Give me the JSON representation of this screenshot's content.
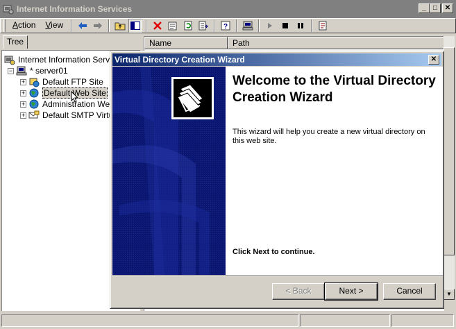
{
  "window": {
    "title": "Internet Information Services",
    "controls": {
      "minimize": "_",
      "maximize": "□",
      "close": "✕"
    }
  },
  "menubar": {
    "items": [
      {
        "label": "Action",
        "accel": "A",
        "rest": "ction"
      },
      {
        "label": "View",
        "accel": "V",
        "rest": "iew"
      }
    ]
  },
  "toolbar": {
    "icons": [
      "back-arrow-icon",
      "forward-arrow-icon",
      "up-folder-icon",
      "show-hide-tree-icon",
      "delete-icon",
      "properties-icon",
      "refresh-icon",
      "export-list-icon",
      "help-icon",
      "computer-icon",
      "start-icon",
      "stop-icon",
      "pause-icon",
      "script-icon"
    ]
  },
  "tabs": {
    "tree": "Tree"
  },
  "tree": {
    "root": "Internet Information Services",
    "server": "* server01",
    "sites": [
      {
        "label": "Default FTP Site",
        "icon": "ftp-site-icon"
      },
      {
        "label": "Default Web Site",
        "icon": "web-site-icon",
        "selected": true
      },
      {
        "label": "Administration Web",
        "icon": "web-site-icon"
      },
      {
        "label": "Default SMTP Virtu",
        "icon": "smtp-site-icon"
      }
    ]
  },
  "list": {
    "columns": [
      "Name",
      "Path"
    ]
  },
  "wizard": {
    "title": "Virtual Directory Creation Wizard",
    "heading": "Welcome to the Virtual Directory Creation Wizard",
    "description": "This wizard will help you create a new virtual directory on this web site.",
    "continue_text": "Click Next to continue.",
    "buttons": {
      "back": {
        "label": "< Back",
        "enabled": false
      },
      "next": {
        "label": "Next >",
        "enabled": true
      },
      "cancel": {
        "label": "Cancel",
        "enabled": true
      }
    }
  },
  "colors": {
    "title_inactive": "#808080",
    "wizard_title_start": "#0a246a",
    "wizard_title_end": "#a6caf0",
    "wizard_side": "#0a1670",
    "face": "#d4d0c8"
  }
}
